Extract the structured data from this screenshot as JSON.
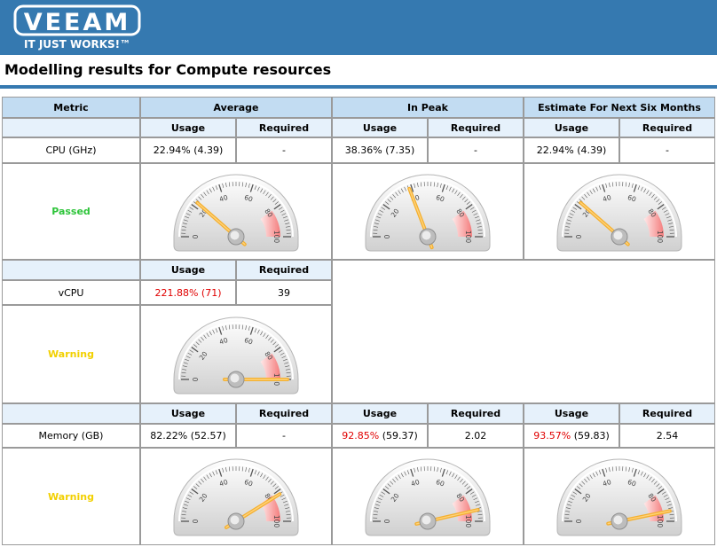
{
  "banner": {
    "logo_text": "VEEAM",
    "tagline": "IT JUST WORKS!™"
  },
  "page_title": "Modelling results for Compute resources",
  "headers": {
    "metric": "Metric",
    "average": "Average",
    "in_peak": "In Peak",
    "estimate": "Estimate For Next Six Months",
    "usage": "Usage",
    "required": "Required"
  },
  "gauge_ticks": [
    "0",
    "20",
    "40",
    "60",
    "80",
    "100"
  ],
  "cpu": {
    "name": "CPU (GHz)",
    "status": "Passed",
    "average": {
      "usage_pct": "22.94%",
      "usage_val": "(4.39)",
      "required": "-",
      "gauge_value": 22.94
    },
    "peak": {
      "usage_pct": "38.36%",
      "usage_val": "(7.35)",
      "required": "-",
      "gauge_value": 38.36
    },
    "estimate": {
      "usage_pct": "22.94%",
      "usage_val": "(4.39)",
      "required": "-",
      "gauge_value": 22.94
    }
  },
  "vcpu": {
    "name": "vCPU",
    "status": "Warning",
    "average": {
      "usage": "221.88% (71)",
      "required": "39",
      "gauge_value": 100
    }
  },
  "memory": {
    "name": "Memory (GB)",
    "status": "Warning",
    "average": {
      "usage_pct": "82.22%",
      "usage_val": "(52.57)",
      "required": "-",
      "gauge_value": 82.22
    },
    "peak": {
      "usage_pct": "92.85%",
      "usage_val": "(59.37)",
      "required": "2.02",
      "gauge_value": 92.85
    },
    "estimate": {
      "usage_pct": "93.57%",
      "usage_val": "(59.83)",
      "required": "2.54",
      "gauge_value": 93.57
    }
  },
  "colors": {
    "banner": "#3579b0",
    "header_bg": "#c2dcf2",
    "subheader_bg": "#e6f1fb",
    "passed": "#2ec43a",
    "warning": "#f2d000",
    "over_limit_text": "#e00000",
    "needle": "#f7b733"
  }
}
